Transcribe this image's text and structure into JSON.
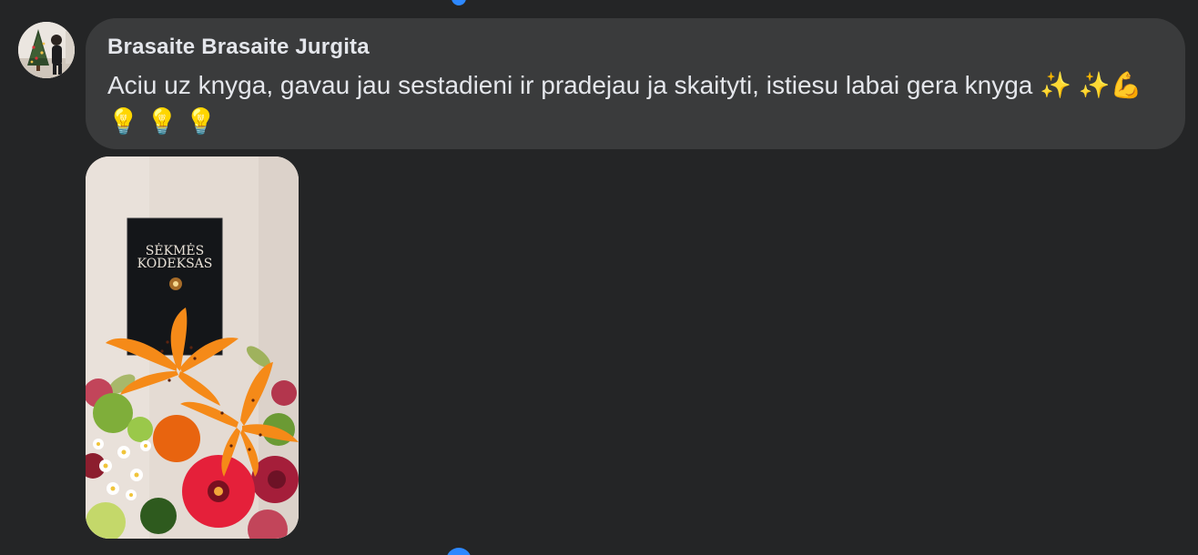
{
  "comment": {
    "author": "Brasaite Brasaite Jurgita",
    "text": "Aciu uz knyga, gavau jau sestadieni ir pradejau ja skaityti, istiesu labai gera knyga ✨ ✨💪💡 💡 💡"
  },
  "photo": {
    "book_title_line1": "SĖKMĖS",
    "book_title_line2": "KODEKSAS"
  },
  "icons": {
    "avatar": "user-avatar",
    "sparkles": "sparkles-emoji",
    "flexed_biceps": "flexed-biceps-emoji",
    "light_bulb": "light-bulb-emoji"
  },
  "colors": {
    "background": "#242526",
    "bubble": "#3a3b3c",
    "text": "#e4e6eb",
    "accent_blue": "#2d88ff"
  }
}
